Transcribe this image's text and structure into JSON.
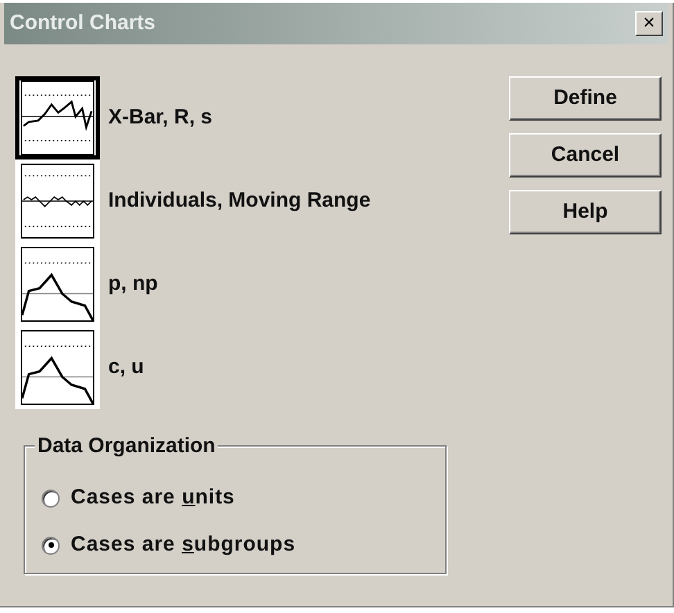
{
  "window": {
    "title": "Control Charts",
    "close": "×"
  },
  "chart_types": [
    {
      "label": "X-Bar, R, s",
      "selected": true,
      "kind": "xbar"
    },
    {
      "label": "Individuals, Moving Range",
      "selected": false,
      "kind": "individuals"
    },
    {
      "label": "p, np",
      "selected": false,
      "kind": "attribute"
    },
    {
      "label": "c, u",
      "selected": false,
      "kind": "attribute"
    }
  ],
  "buttons": [
    "Define",
    "Cancel",
    "Help"
  ],
  "data_organization": {
    "title": "Data Organization",
    "options": [
      {
        "before": "Cases are ",
        "mnemonic": "u",
        "after": "nits",
        "selected": false
      },
      {
        "before": "Cases are ",
        "mnemonic": "s",
        "after": "ubgroups",
        "selected": true
      }
    ]
  }
}
